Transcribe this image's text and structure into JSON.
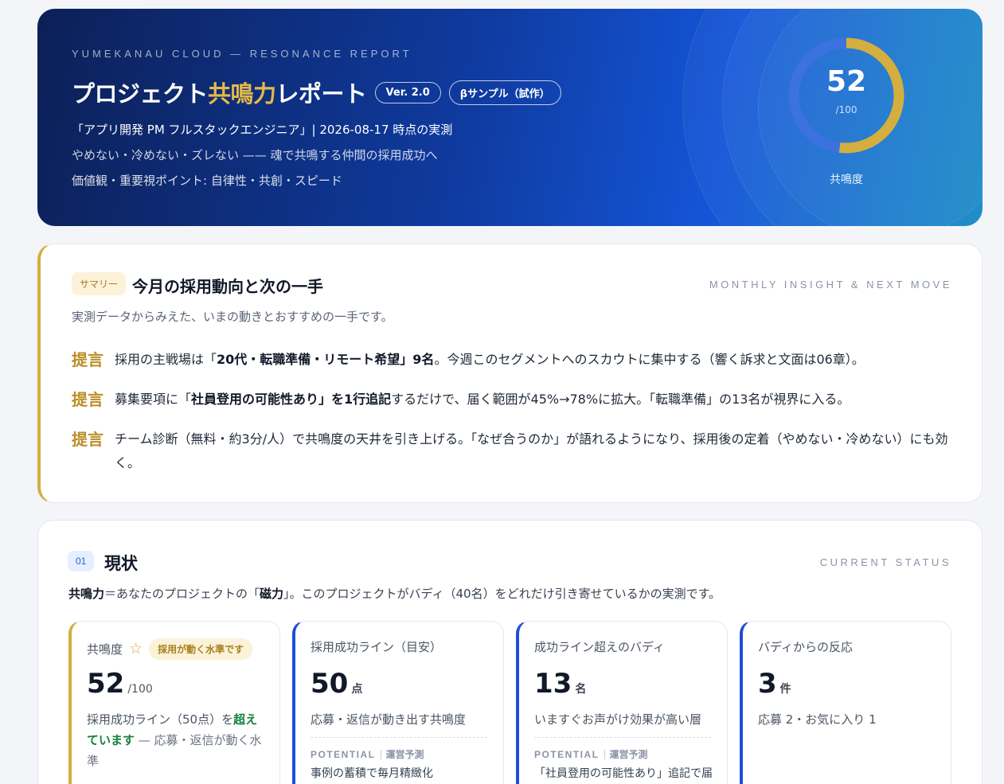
{
  "hero": {
    "kicker": "YUMEKANAU CLOUD — RESONANCE REPORT",
    "title_pre": "プロジェクト",
    "title_accent": "共鳴力",
    "title_post": "レポート",
    "version_pill": "Ver. 2.0",
    "beta_pill": "βサンプル（試作）",
    "subtitle": "「アプリ開発 PM フルスタックエンジニア」| 2026-08-17 時点の実測",
    "tagline": "やめない・冷めない・ズレない —— 魂で共鳴する仲間の採用成功へ",
    "values_line": "価値観・重要視ポイント: 自律性・共創・スピード",
    "gauge": {
      "value": "52",
      "max_label": "/100",
      "label": "共鳴度",
      "fraction": 0.52,
      "track_color": "#3c72e0",
      "fill_color": "#d4ae3e"
    }
  },
  "summary": {
    "tag": "サマリー",
    "heading": "今月の採用動向と次の一手",
    "english": "MONTHLY INSIGHT & NEXT MOVE",
    "lead": "実測データからみえた、いまの動きとおすすめの一手です。",
    "badge": "提言",
    "proposals": [
      {
        "a": "採用の主戦場は「",
        "b": "20代・転職準備・リモート希望",
        "c": "」9名",
        "d": "。今週このセグメントへのスカウトに集中する（響く訴求と文面は06章）。"
      },
      {
        "a": "募集要項に「",
        "b": "社員登用の可能性あり",
        "c": "」を1行追記",
        "d": "するだけで、届く範囲が45%→78%に拡大。「転職準備」の13名が視界に入る。"
      },
      {
        "text": "チーム診断（無料・約3分/人）で共鳴度の天井を引き上げる。「なぜ合うのか」が語れるようになり、採用後の定着（やめない・冷めない）にも効く。"
      }
    ]
  },
  "status": {
    "number": "01",
    "title": "現状",
    "english": "CURRENT STATUS",
    "desc_bold": "共鳴力",
    "desc_mid": "＝あなたのプロジェクトの「",
    "desc_bold2": "磁力",
    "desc_tail": "」。このプロジェクトがバディ（40名）をどれだけ引き寄せているかの実測です。",
    "cards": [
      {
        "label": "共鳴度",
        "star_icon": "star-outline-icon",
        "badge": "採用が動く水準です",
        "value": "52",
        "unit": "/100",
        "note_a": "採用成功ライン（50点）を",
        "note_ok": "超えています",
        "note_dim": " — 応募・返信が動く水準"
      },
      {
        "label": "採用成功ライン（目安）",
        "value": "50",
        "unit": "点",
        "note": "応募・返信が動き出す共鳴度",
        "potential_key": "POTENTIAL",
        "potential_val": "運営予測",
        "potential_text": "事例の蓄積で毎月精緻化"
      },
      {
        "label": "成功ライン超えのバディ",
        "value": "13",
        "unit": "名",
        "note": "いますぐお声がけ効果が高い層",
        "potential_key": "POTENTIAL",
        "potential_val": "運営予測",
        "potential_text": "「社員登用の可能性あり」追記で届"
      },
      {
        "label": "バディからの反応",
        "value": "3",
        "unit": "件",
        "note": "応募 2・お気に入り 1"
      }
    ]
  }
}
